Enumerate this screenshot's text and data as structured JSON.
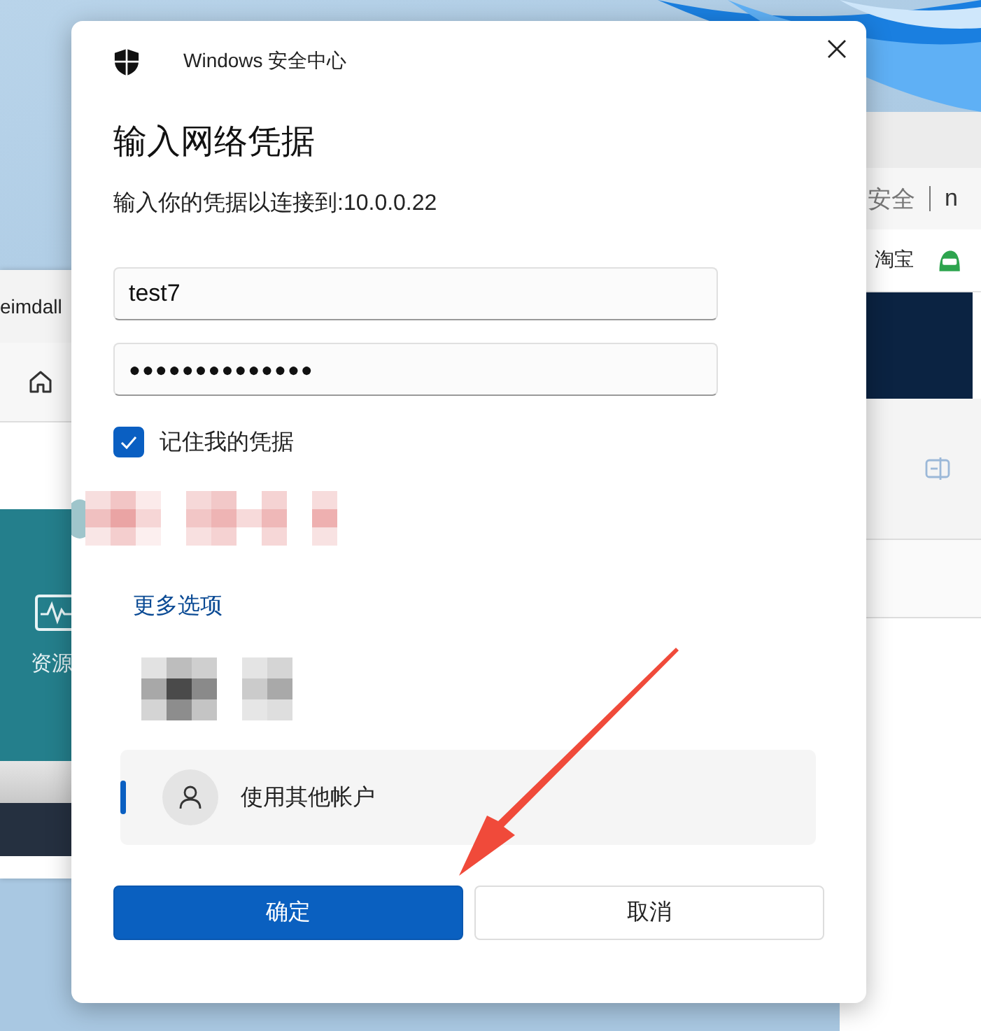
{
  "background": {
    "left_window": {
      "title": "eimdall",
      "tile_label": "资源"
    },
    "right_window": {
      "address": "安全",
      "address_tail": "n",
      "bookmark": "淘宝"
    }
  },
  "window": {
    "app_name": "Windows 安全中心"
  },
  "heading": "输入网络凭据",
  "message": "输入你的凭据以连接到:10.0.0.22",
  "username": {
    "value": "test7"
  },
  "password": {
    "value": "●●●●●●●●●●●●●●"
  },
  "remember": {
    "label": "记住我的凭据",
    "checked": true
  },
  "more_options": "更多选项",
  "accounts": [
    {
      "kind": "blurred",
      "selected": false
    },
    {
      "kind": "other",
      "label": "使用其他帐户",
      "selected": true
    }
  ],
  "buttons": [
    {
      "label": "确定",
      "kind": "primary"
    },
    {
      "label": "取消",
      "kind": "secondary"
    }
  ]
}
